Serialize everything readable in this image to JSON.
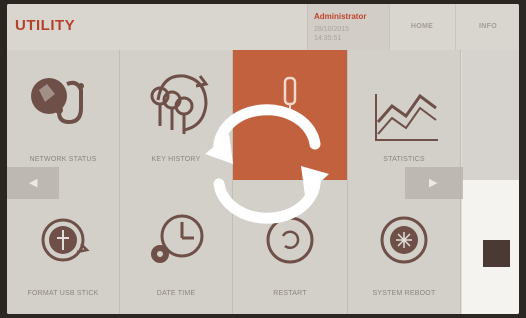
{
  "header": {
    "title": "UTILITY",
    "user": "Administrator",
    "date": "28/10/2015",
    "time": "14:35:51",
    "home_label": "HOME",
    "info_label": "INFO"
  },
  "tiles": [
    {
      "label": "NETWORK STATUS",
      "icon": "network-stethoscope-icon"
    },
    {
      "label": "KEY HISTORY",
      "icon": "key-history-icon"
    },
    {
      "label": "",
      "icon": "probe-icon"
    },
    {
      "label": "STATISTICS",
      "icon": "statistics-chart-icon"
    },
    {
      "label": "FORMAT USB STICK",
      "icon": "usb-format-icon"
    },
    {
      "label": "DATE TIME",
      "icon": "date-time-icon"
    },
    {
      "label": "RESTART",
      "icon": "restart-icon"
    },
    {
      "label": "SYSTEM REBOOT",
      "icon": "system-reboot-icon"
    }
  ],
  "overlay": {
    "icon": "sync-loading-icon"
  },
  "colors": {
    "accent": "#b4412a",
    "active_tile": "#c1613d",
    "icon_stroke": "#6e5048"
  }
}
